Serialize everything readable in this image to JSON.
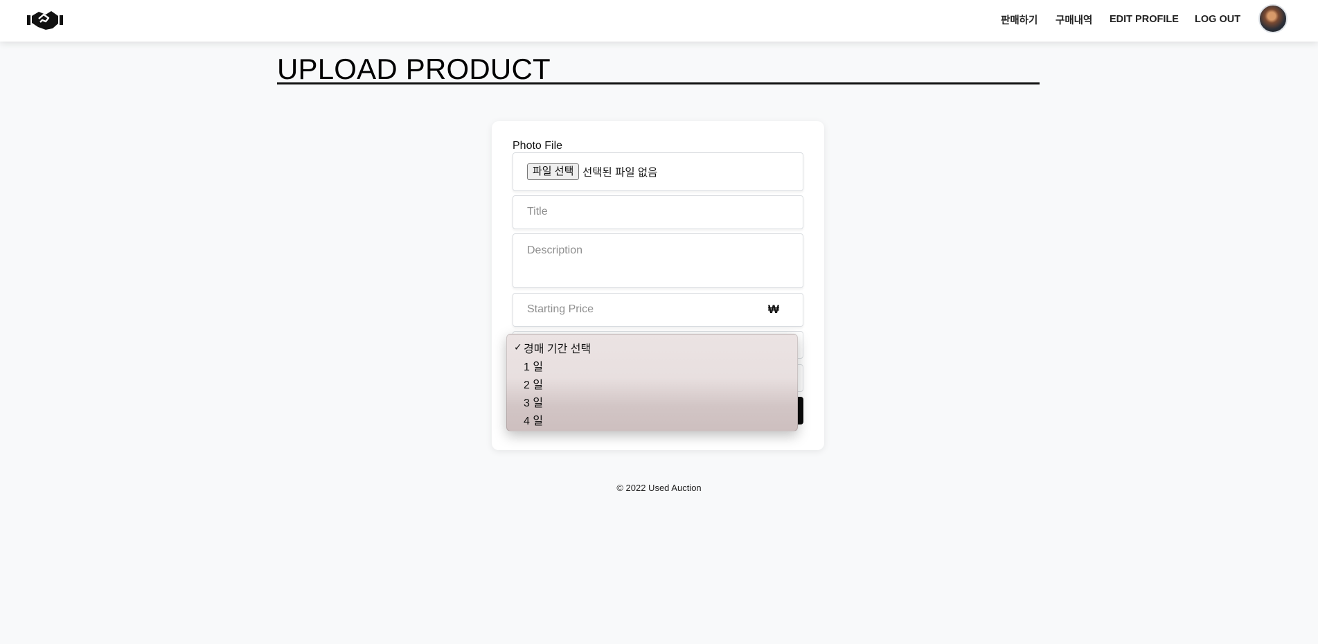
{
  "nav": {
    "items": [
      {
        "label": "판매하기"
      },
      {
        "label": "구매내역"
      },
      {
        "label": "EDIT PROFILE"
      },
      {
        "label": "LOG OUT"
      }
    ],
    "logo_icon": "handshake-icon",
    "avatar": "user-avatar"
  },
  "page": {
    "title": "UPLOAD PRODUCT"
  },
  "form": {
    "photo_label": "Photo File",
    "file_button": "파일 선택",
    "file_status": "선택된 파일 없음",
    "title_placeholder": "Title",
    "description_placeholder": "Description",
    "price_placeholder": "Starting Price",
    "currency_symbol": "₩"
  },
  "dropdown": {
    "check_mark": "✓",
    "selected_index": 0,
    "options": [
      "경매 기간 선택",
      "1 일",
      "2 일",
      "3 일",
      "4 일"
    ]
  },
  "footer": {
    "text": "© 2022 Used Auction"
  },
  "colors": {
    "background": "#f8f9fa",
    "primary_button": "#0b0b0b"
  }
}
